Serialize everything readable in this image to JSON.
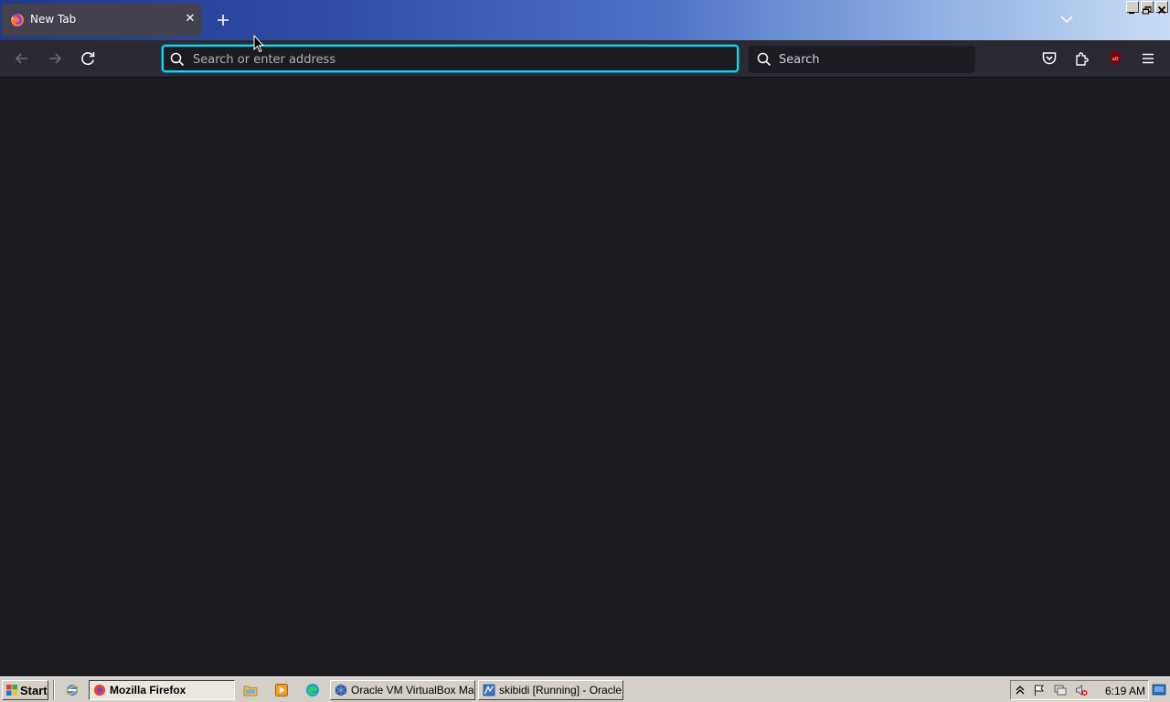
{
  "browser": {
    "tab": {
      "title": "New Tab",
      "close": "✕"
    },
    "urlbar": {
      "placeholder": "Search or enter address",
      "value": ""
    },
    "searchbar": {
      "placeholder": "Search"
    },
    "extension_badge": "uO",
    "accent": "#00ddff"
  },
  "taskbar": {
    "start_label": "Start",
    "tasks": [
      {
        "label": "Mozilla Firefox",
        "active": true
      },
      {
        "label": "Oracle VM VirtualBox Ma...",
        "active": false
      },
      {
        "label": "skibidi [Running] - Oracle...",
        "active": false
      }
    ],
    "clock": "6:19 AM"
  }
}
